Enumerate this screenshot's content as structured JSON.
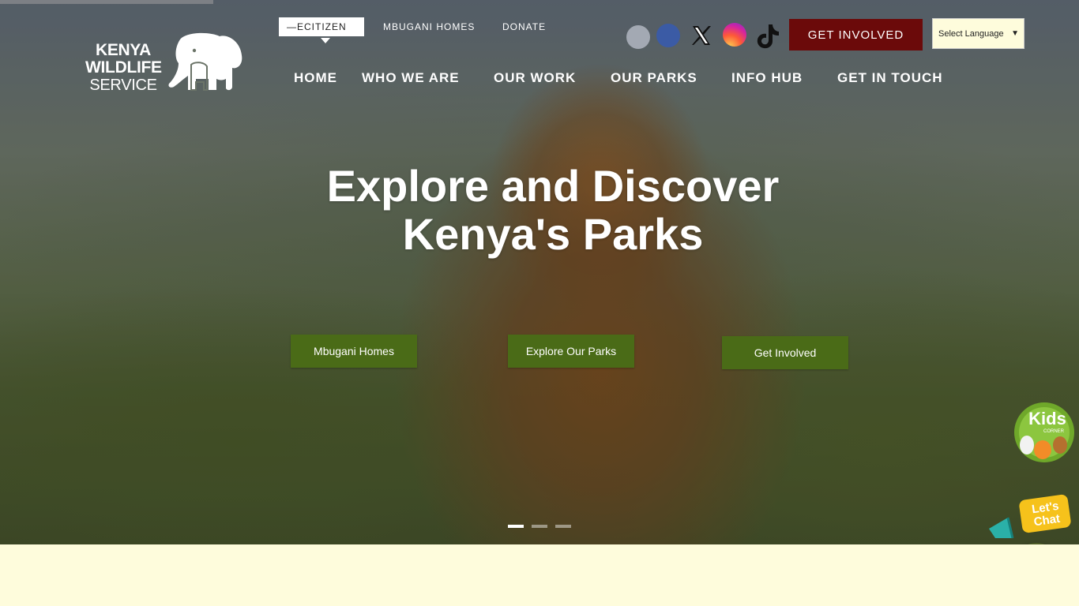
{
  "header": {
    "logo": {
      "line1": "KENYA",
      "line2": "WILDLIFE",
      "line3": "SERVICE"
    },
    "top_links": {
      "ecitizen": "—ECITIZEN",
      "homes": "MBUGANI HOMES",
      "donate": "DONATE"
    },
    "social_icons": [
      "circle-icon",
      "facebook-icon",
      "x-icon",
      "instagram-icon",
      "tiktok-icon"
    ],
    "get_involved": "GET INVOLVED",
    "language_select": "Select Language"
  },
  "nav": {
    "items": [
      {
        "label": "HOME"
      },
      {
        "label": "WHO WE ARE"
      },
      {
        "label": "OUR WORK"
      },
      {
        "label": "OUR PARKS"
      },
      {
        "label": "INFO HUB"
      },
      {
        "label": "GET IN TOUCH"
      }
    ]
  },
  "hero": {
    "title_line1": "Explore and Discover",
    "title_line2": "Kenya's Parks",
    "buttons": [
      {
        "label": "Mbugani Homes"
      },
      {
        "label": "Explore Our Parks"
      },
      {
        "label": "Get Involved"
      }
    ],
    "slides_count": 3,
    "active_slide": 1
  },
  "widgets": {
    "kids_badge": "Kids",
    "kids_badge_sub": "CORNER",
    "chat_promo_line1": "Let's",
    "chat_promo_line2": "Chat"
  },
  "colors": {
    "accent_dark_red": "#6b0a0a",
    "cta_green": "#4a6b17",
    "lower_bg": "#fefcdc",
    "chat_bubble": "#4e5e26"
  }
}
